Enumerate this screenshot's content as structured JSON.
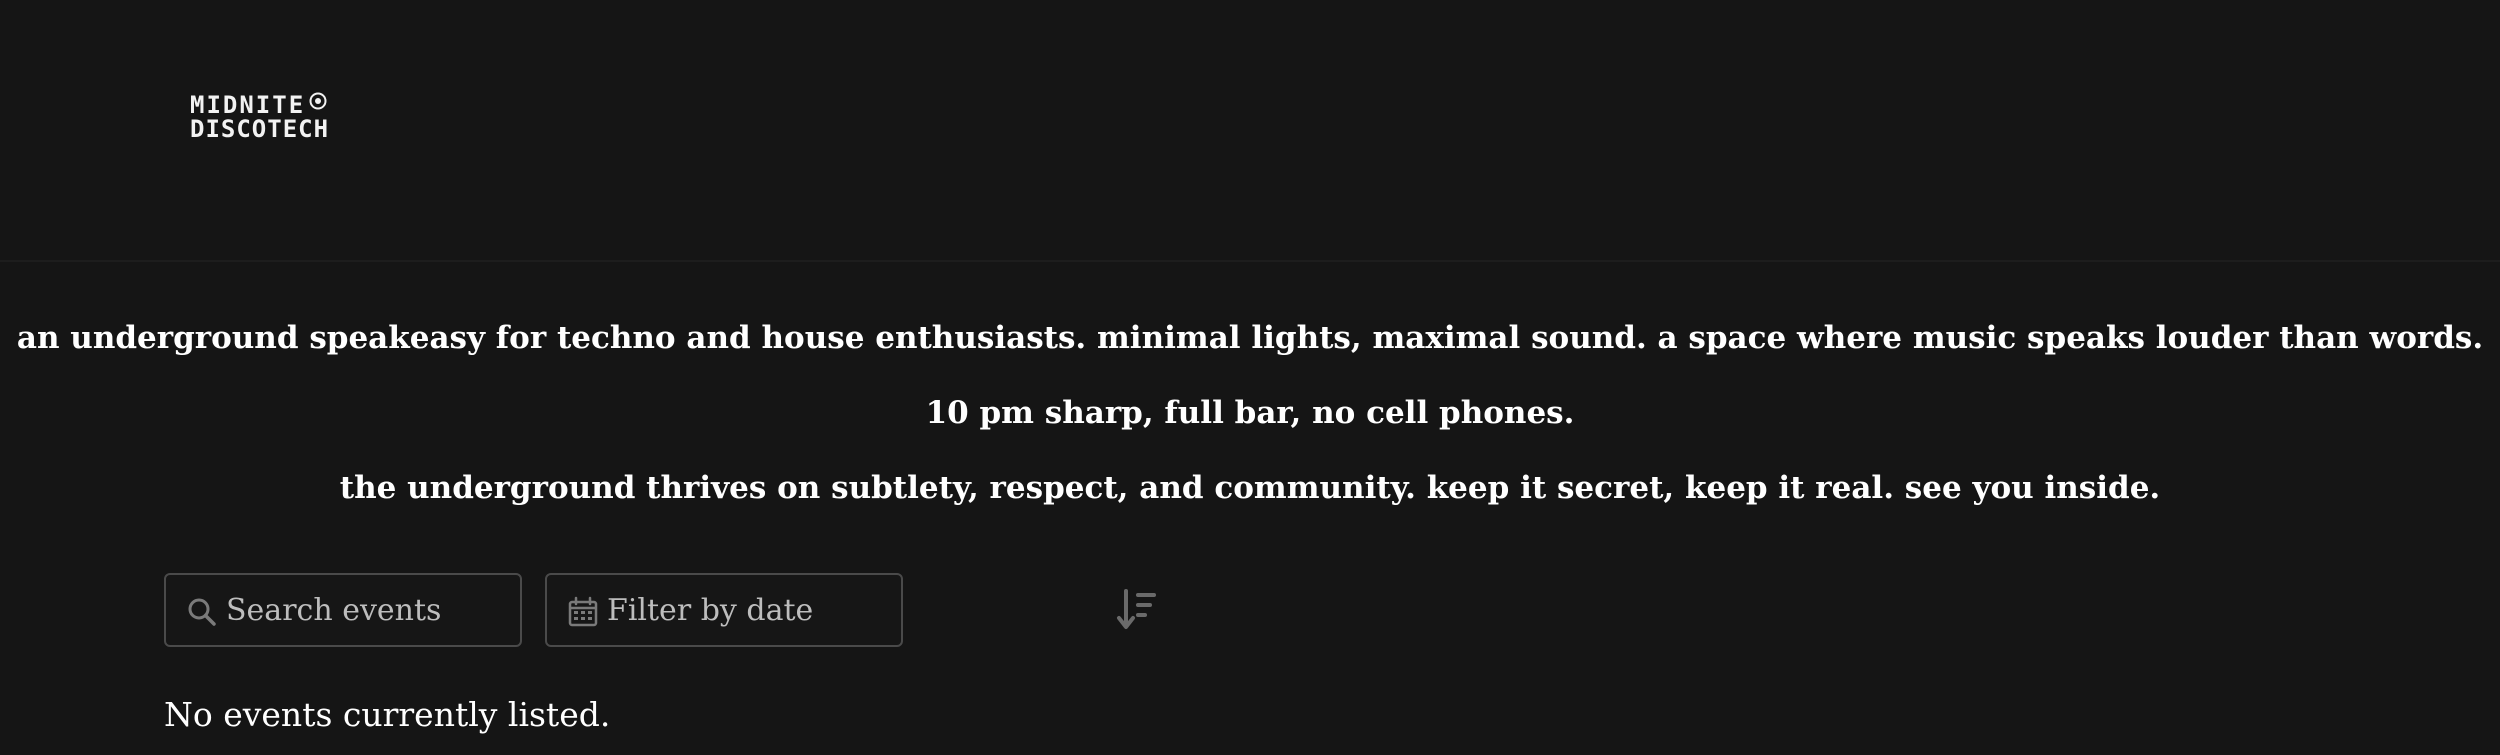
{
  "header": {
    "logo": {
      "line1": "MIDNITE",
      "line2": "DISCOTECH"
    }
  },
  "intro": {
    "paragraphs": [
      "an underground speakeasy for techno and house enthusiasts. minimal lights, maximal sound. a space where music speaks louder than words.",
      "10 pm sharp, full bar, no cell phones.",
      "the underground thrives on subtlety, respect, and community. keep it secret, keep it real. see you inside."
    ]
  },
  "filters": {
    "search_placeholder": "Search events",
    "date_placeholder": "Filter by date",
    "search_icon": "search-icon",
    "date_icon": "calendar-icon",
    "sort_icon": "sort-descending-icon"
  },
  "events": {
    "empty_message": "No events currently listed."
  },
  "colors": {
    "background": "#151515",
    "text": "#ffffff",
    "border": "#4a4a4a",
    "icon": "#7a7a7a"
  }
}
